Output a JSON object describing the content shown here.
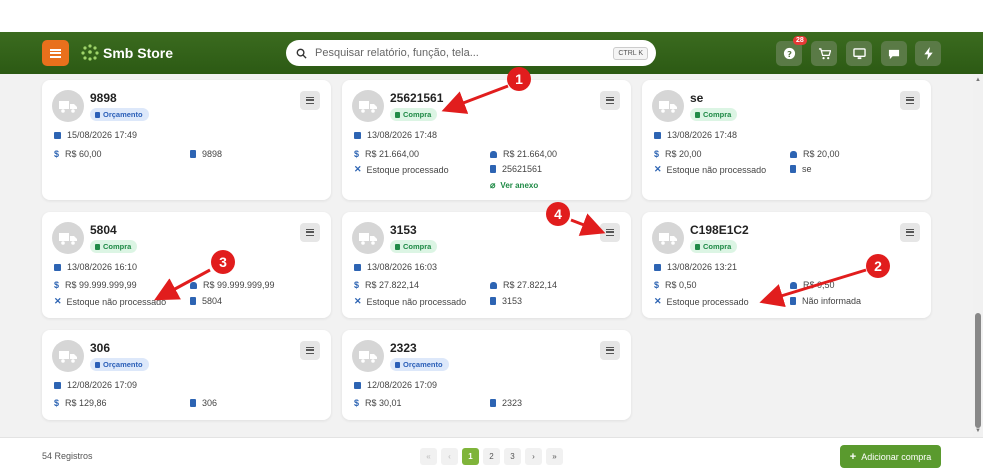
{
  "app": {
    "brand": "Smb Store"
  },
  "search": {
    "placeholder": "Pesquisar relatório, função, tela...",
    "shortcut": "CTRL K"
  },
  "nav": {
    "help_badge": "28"
  },
  "cards": [
    {
      "title": "9898",
      "tag": "Orçamento",
      "date": "15/08/2026 17:49",
      "value": "R$ 60,00",
      "doc": "9898"
    },
    {
      "title": "25621561",
      "tag": "Compra",
      "date": "13/08/2026 17:48",
      "value": "R$ 21.664,00",
      "value2": "R$ 21.664,00",
      "stock": "Estoque processado",
      "doc": "25621561",
      "attachment": "Ver anexo"
    },
    {
      "title": "se",
      "tag": "Compra",
      "date": "13/08/2026 17:48",
      "value": "R$ 20,00",
      "value2": "R$ 20,00",
      "stock": "Estoque não processado",
      "doc": "se"
    },
    {
      "title": "5804",
      "tag": "Compra",
      "date": "13/08/2026 16:10",
      "value": "R$ 99.999.999,99",
      "value2": "R$ 99.999.999,99",
      "stock": "Estoque não processado",
      "doc": "5804"
    },
    {
      "title": "3153",
      "tag": "Compra",
      "date": "13/08/2026 16:03",
      "value": "R$ 27.822,14",
      "value2": "R$ 27.822,14",
      "stock": "Estoque não processado",
      "doc": "3153"
    },
    {
      "title": "C198E1C2",
      "tag": "Compra",
      "date": "13/08/2026 13:21",
      "value": "R$ 0,50",
      "value2": "R$ 0,50",
      "stock": "Estoque processado",
      "doc": "Não informada"
    },
    {
      "title": "306",
      "tag": "Orçamento",
      "date": "12/08/2026 17:09",
      "value": "R$ 129,86",
      "doc": "306"
    },
    {
      "title": "2323",
      "tag": "Orçamento",
      "date": "12/08/2026 17:09",
      "value": "R$ 30,01",
      "doc": "2323"
    }
  ],
  "footer": {
    "records": "54 Registros",
    "pages": [
      "1",
      "2",
      "3"
    ],
    "first": "«",
    "prev": "‹",
    "next": "›",
    "last": "»",
    "add_label": "Adicionar compra",
    "add_icon": "+"
  },
  "annotations": {
    "n1": "1",
    "n2": "2",
    "n3": "3",
    "n4": "4"
  },
  "colors": {
    "navbar": "#2c5a14",
    "accent_orange": "#e8701c",
    "compra_tag": "#1f8a46",
    "orcamento_tag": "#2b5fb8",
    "annotation_red": "#e11d1d",
    "active_page": "#7fb43a"
  }
}
